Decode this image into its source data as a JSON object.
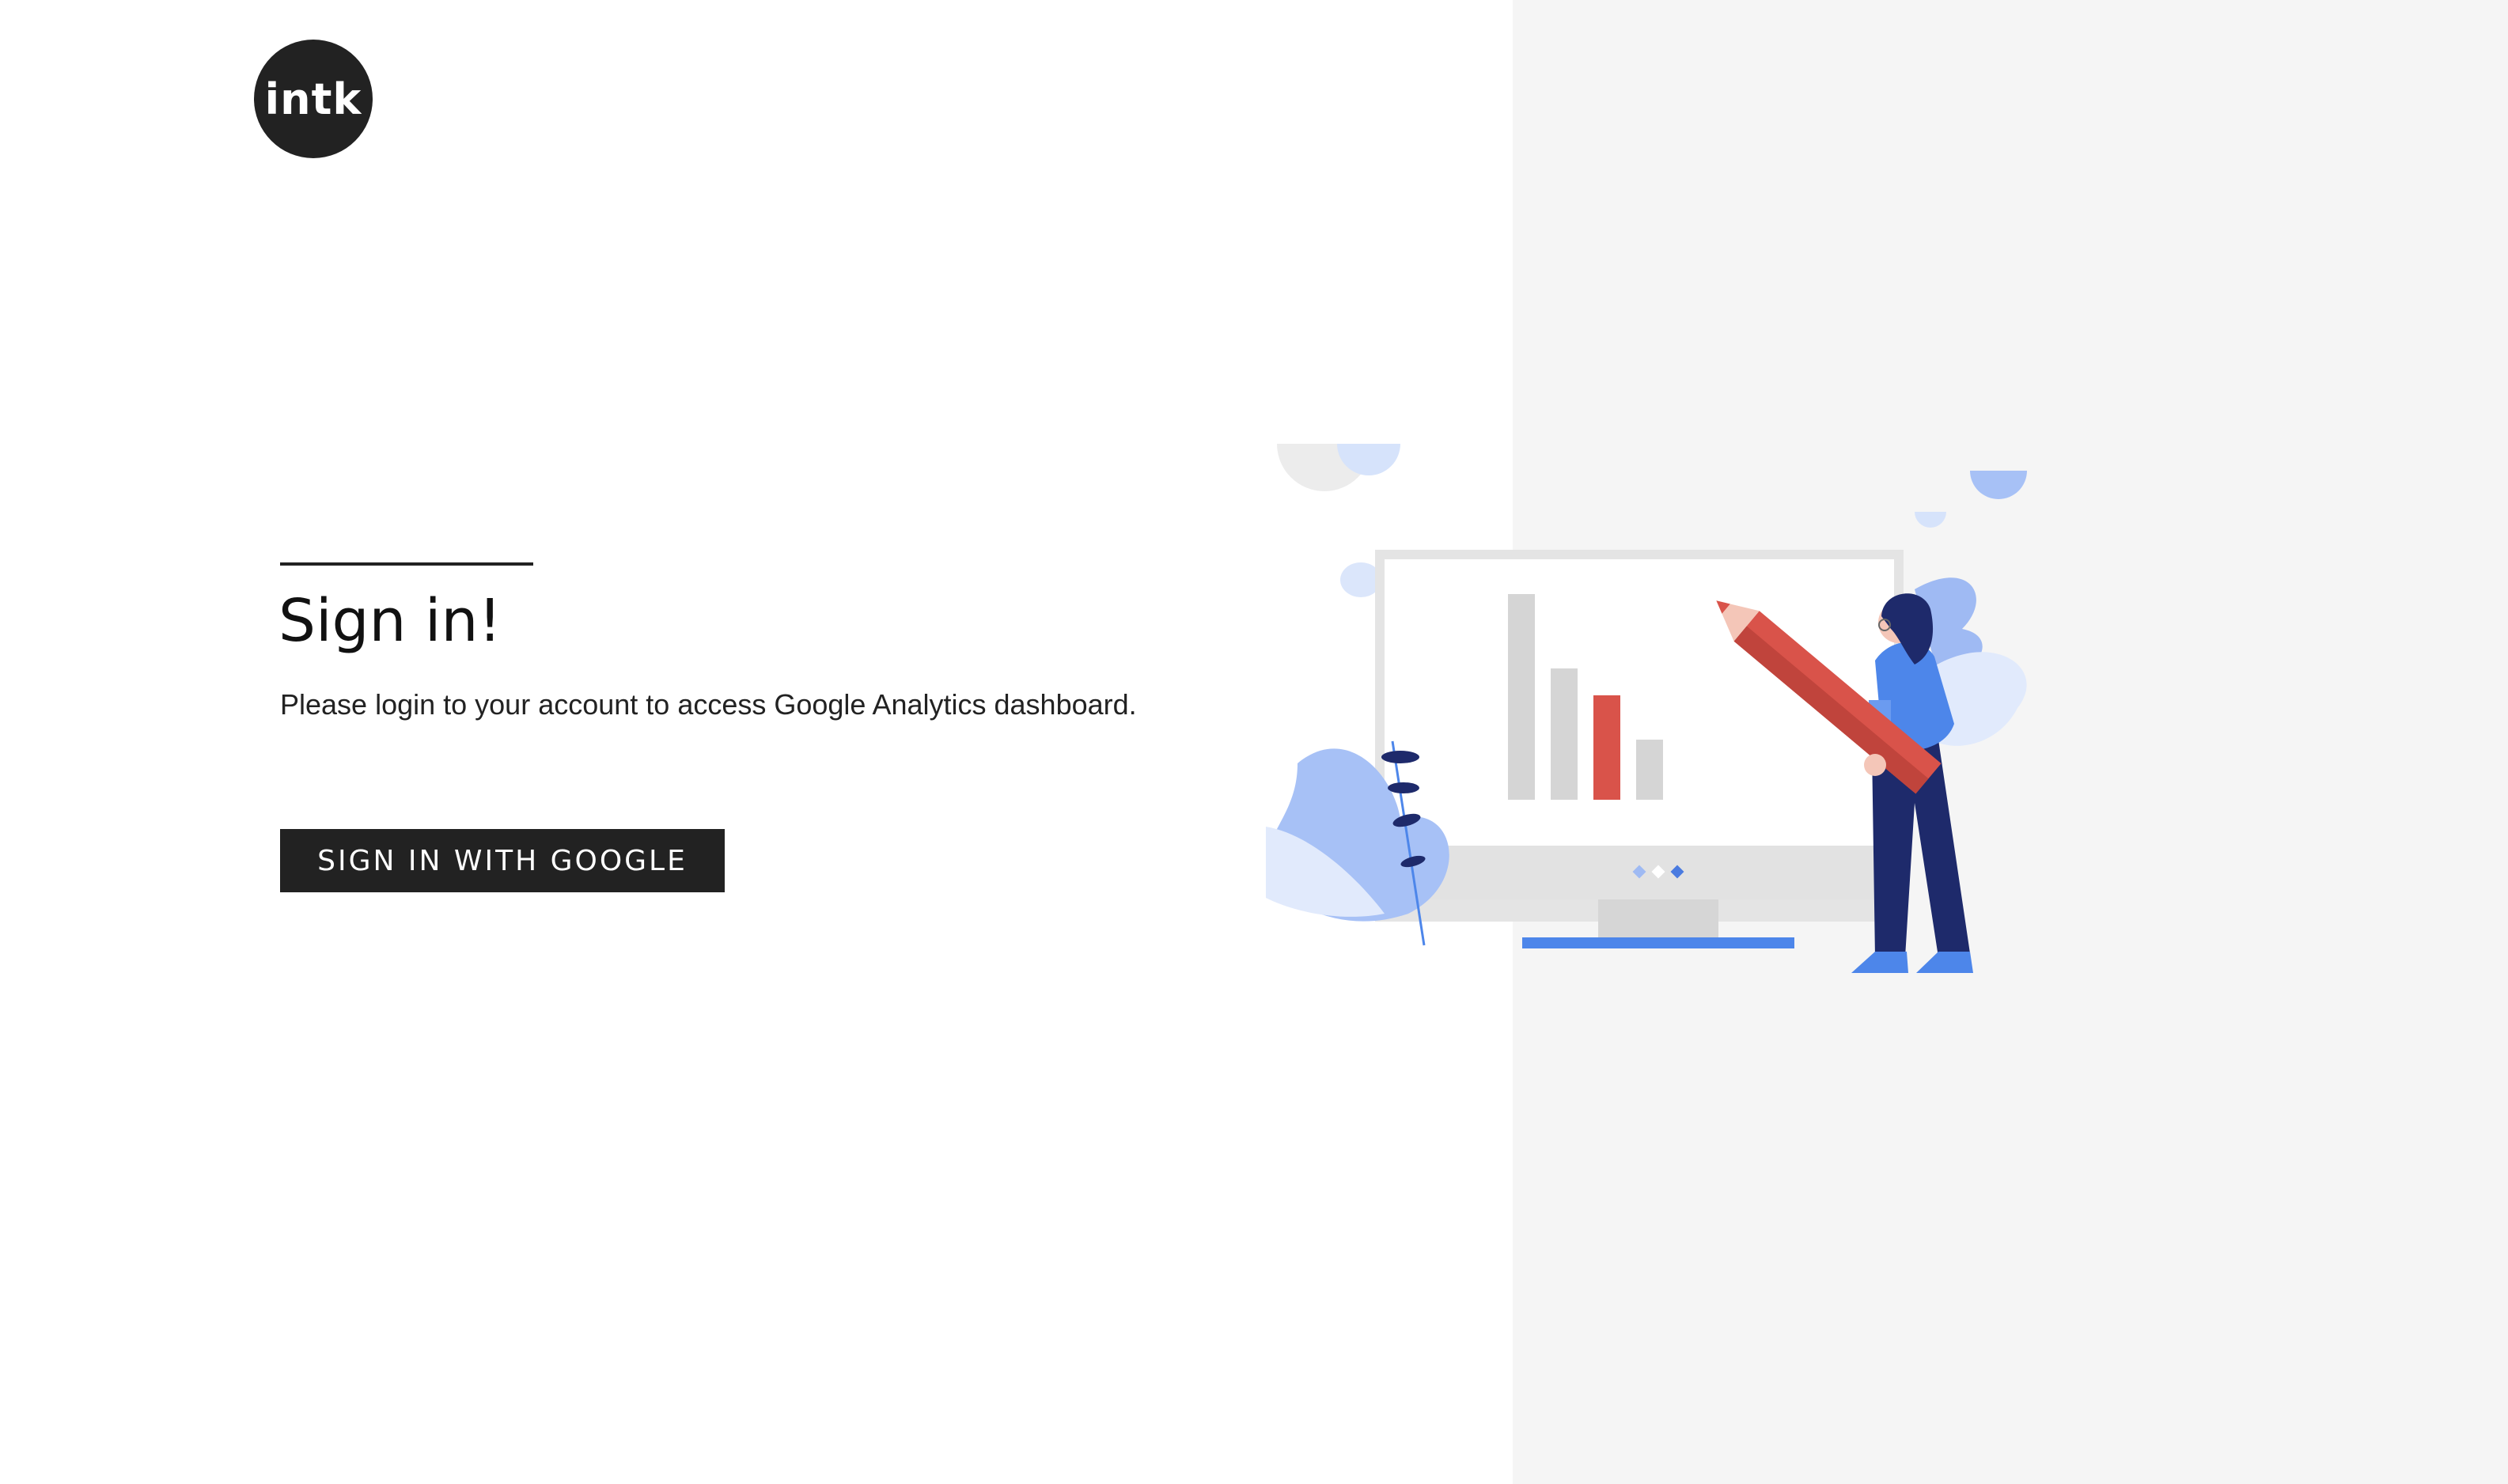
{
  "logo": {
    "text": "intk"
  },
  "signin": {
    "title": "Sign in!",
    "subtitle": "Please login to your account to access Google Analytics dashboard.",
    "button_label": "SIGN IN WITH GOOGLE"
  },
  "colors": {
    "dark": "#222222",
    "panel_bg": "#f5f5f5",
    "accent_blue": "#5b8def",
    "accent_red": "#d9534a",
    "navy": "#1e2a6b"
  },
  "illustration": {
    "icon": "analytics-illustration-icon"
  }
}
